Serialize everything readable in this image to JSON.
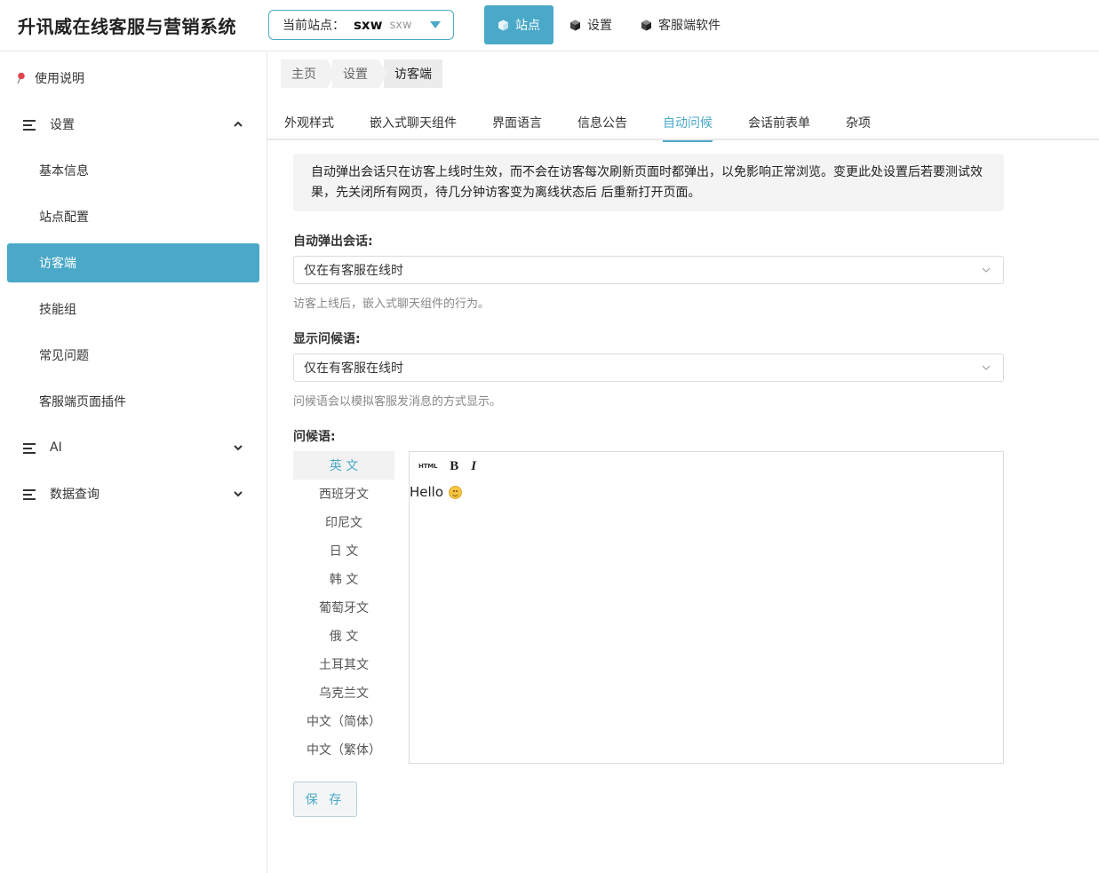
{
  "header": {
    "app_title": "升讯威在线客服与营销系统",
    "site_selector": {
      "label": "当前站点：",
      "code": "sxw",
      "name": "sxw"
    },
    "nav": [
      {
        "label": "站点",
        "icon": "cube-icon",
        "active": true
      },
      {
        "label": "设置",
        "icon": "cube-icon",
        "active": false
      },
      {
        "label": "客服端软件",
        "icon": "cube-icon",
        "active": false
      }
    ]
  },
  "sidebar": {
    "items": [
      {
        "label": "使用说明",
        "type": "link",
        "icon": "pin-icon"
      },
      {
        "label": "设置",
        "type": "group",
        "expanded": true
      },
      {
        "label": "基本信息",
        "type": "sub"
      },
      {
        "label": "站点配置",
        "type": "sub"
      },
      {
        "label": "访客端",
        "type": "sub",
        "active": true
      },
      {
        "label": "技能组",
        "type": "sub"
      },
      {
        "label": "常见问题",
        "type": "sub"
      },
      {
        "label": "客服端页面插件",
        "type": "sub"
      },
      {
        "label": "AI",
        "type": "group",
        "expanded": false
      },
      {
        "label": "数据查询",
        "type": "group",
        "expanded": false
      }
    ]
  },
  "breadcrumb": [
    "主页",
    "设置",
    "访客端"
  ],
  "tabs": [
    {
      "label": "外观样式"
    },
    {
      "label": "嵌入式聊天组件"
    },
    {
      "label": "界面语言"
    },
    {
      "label": "信息公告"
    },
    {
      "label": "自动问候",
      "active": true
    },
    {
      "label": "会话前表单"
    },
    {
      "label": "杂项"
    }
  ],
  "notice": "自动弹出会话只在访客上线时生效，而不会在访客每次刷新页面时都弹出，以免影响正常浏览。变更此处设置后若要测试效果，先关闭所有网页，待几分钟访客变为离线状态后 后重新打开页面。",
  "form": {
    "auto_popup": {
      "label": "自动弹出会话:",
      "value": "仅在有客服在线时",
      "help": "访客上线后，嵌入式聊天组件的行为。"
    },
    "show_greeting": {
      "label": "显示问候语:",
      "value": "仅在有客服在线时",
      "help": "问候语会以模拟客服发消息的方式显示。"
    },
    "greeting": {
      "label": "问候语:",
      "languages": [
        "英 文",
        "西班牙文",
        "印尼文",
        "日 文",
        "韩 文",
        "葡萄牙文",
        "俄 文",
        "土耳其文",
        "乌克兰文",
        "中文（简体）",
        "中文（繁体）"
      ],
      "active_language": "英 文",
      "toolbar": {
        "html": "HTML",
        "bold": "B",
        "italic": "I"
      },
      "content": "Hello"
    },
    "save_label": "保 存"
  },
  "colors": {
    "accent": "#4aa8c8",
    "border": "#dcdcdc"
  }
}
